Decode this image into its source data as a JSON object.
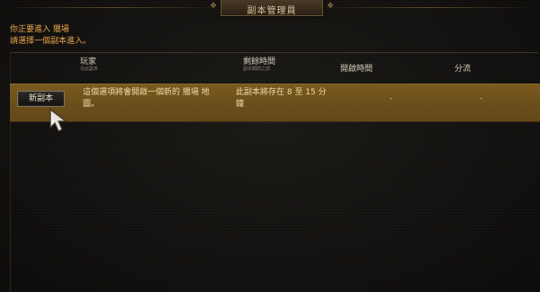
{
  "window": {
    "title": "副本管理員"
  },
  "info": {
    "line1": "你正要進入 獵場",
    "line2": "請選擇一個副本進入。"
  },
  "table": {
    "columns": [
      {
        "label": "玩家",
        "sublabel": "在此副本"
      },
      {
        "label": "剩餘時間",
        "sublabel": "副本關閉之前"
      },
      {
        "label": "開啟時間",
        "sublabel": ""
      },
      {
        "label": "分流",
        "sublabel": ""
      }
    ],
    "rows": [
      {
        "button_label": "新副本",
        "description": "這個選項將會開啟一個新的 獵場 地圖。",
        "remaining": "此副本將存在 8 至 15 分鐘",
        "open_time": "-",
        "channel": "-"
      }
    ]
  },
  "colors": {
    "accent": "#e8a64e",
    "row_highlight": "#6b4e1a",
    "background": "#0f0e0c"
  },
  "icons": {
    "cursor": "mouse-pointer-icon"
  }
}
